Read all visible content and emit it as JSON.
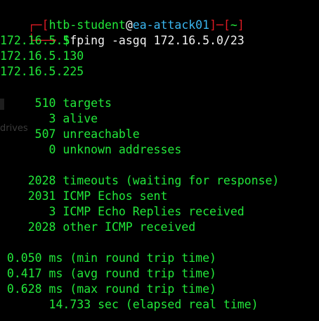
{
  "prompt": {
    "corner_top": "┌─",
    "bracket_open": "[",
    "user": "htb-student",
    "at": "@",
    "host": "ea-attack01",
    "bracket_close": "]",
    "dash": "─",
    "dir_open": "[",
    "dir": "~",
    "dir_close": "]",
    "corner_bottom": "└──╼",
    "symbol": " $",
    "command": "fping -asgq 172.16.5.0/23"
  },
  "alive_hosts": [
    "172.16.5.5",
    "172.16.5.130",
    "172.16.5.225"
  ],
  "stats": [
    "     510 targets",
    "       3 alive",
    "     507 unreachable",
    "       0 unknown addresses",
    "",
    "    2028 timeouts (waiting for response)",
    "    2031 ICMP Echos sent",
    "       3 ICMP Echo Replies received",
    "    2028 other ICMP received",
    "",
    " 0.050 ms (min round trip time)",
    " 0.417 ms (avg round trip time)",
    " 0.628 ms (max round trip time)",
    "       14.733 sec (elapsed real time)"
  ],
  "background_text": "drives",
  "colors": {
    "text": "#22e83a",
    "prompt_frame": "#e01b24",
    "host": "#3ab6f0",
    "background": "#000000"
  }
}
